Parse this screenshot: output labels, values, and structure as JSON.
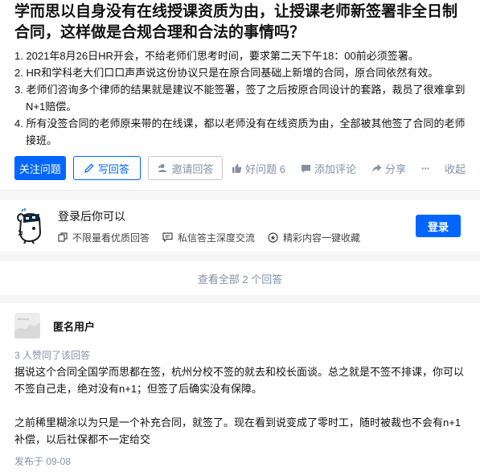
{
  "question": {
    "title": "学而思以自身没有在线授课资质为由，让授课老师新签署非全日制合同，这样做是合规合理和合法的事情吗？",
    "body": [
      "1. 2021年8月26日HR开会，不给老师们思考时间，要求第二天下午18：00前必须签署。",
      "2. HR和学科老大们口口声声说这份协议只是在原合同基础上新增的合同，原合同依然有效。",
      "3. 老师们咨询多个律师的结果就是建议不能签署，签了之后按原合同设计的套路，裁员了很难拿到N+1赔偿。",
      "4. 所有没签合同的老师原来带的在线课，都以老师没有在线资质为由，全部被其他签了合同的老师接班。"
    ]
  },
  "actions": {
    "follow": "关注问题",
    "write_answer": "写回答",
    "invite": "邀请回答",
    "good_question": "好问题 6",
    "comment": "添加评论",
    "share": "分享",
    "more": "···",
    "collapse": "收起"
  },
  "login": {
    "title": "登录后你可以",
    "perks": [
      "不限量看优质回答",
      "私信答主深度交流",
      "精彩内容一键收藏"
    ],
    "button": "登录"
  },
  "view_all": "查看全部 2 个回答",
  "answer": {
    "author": "匿名用户",
    "votes": "3 人赞同了该回答",
    "paragraphs": [
      "据说这个合同全国学而思都在签，杭州分校不签的就去和校长面谈。总之就是不签不排课，你可以不签自己走，绝对没有n+1；但签了后确实没有保障。",
      "之前稀里糊涂以为只是一个补充合同，就签了。现在看到说变成了零时工，随时被裁也不会有n+1补偿，以后社保都不一定给交"
    ],
    "published": "发布于 09-08"
  },
  "colors": {
    "primary": "#0066ff",
    "muted": "#8590a6",
    "background": "#f6f6f6"
  }
}
